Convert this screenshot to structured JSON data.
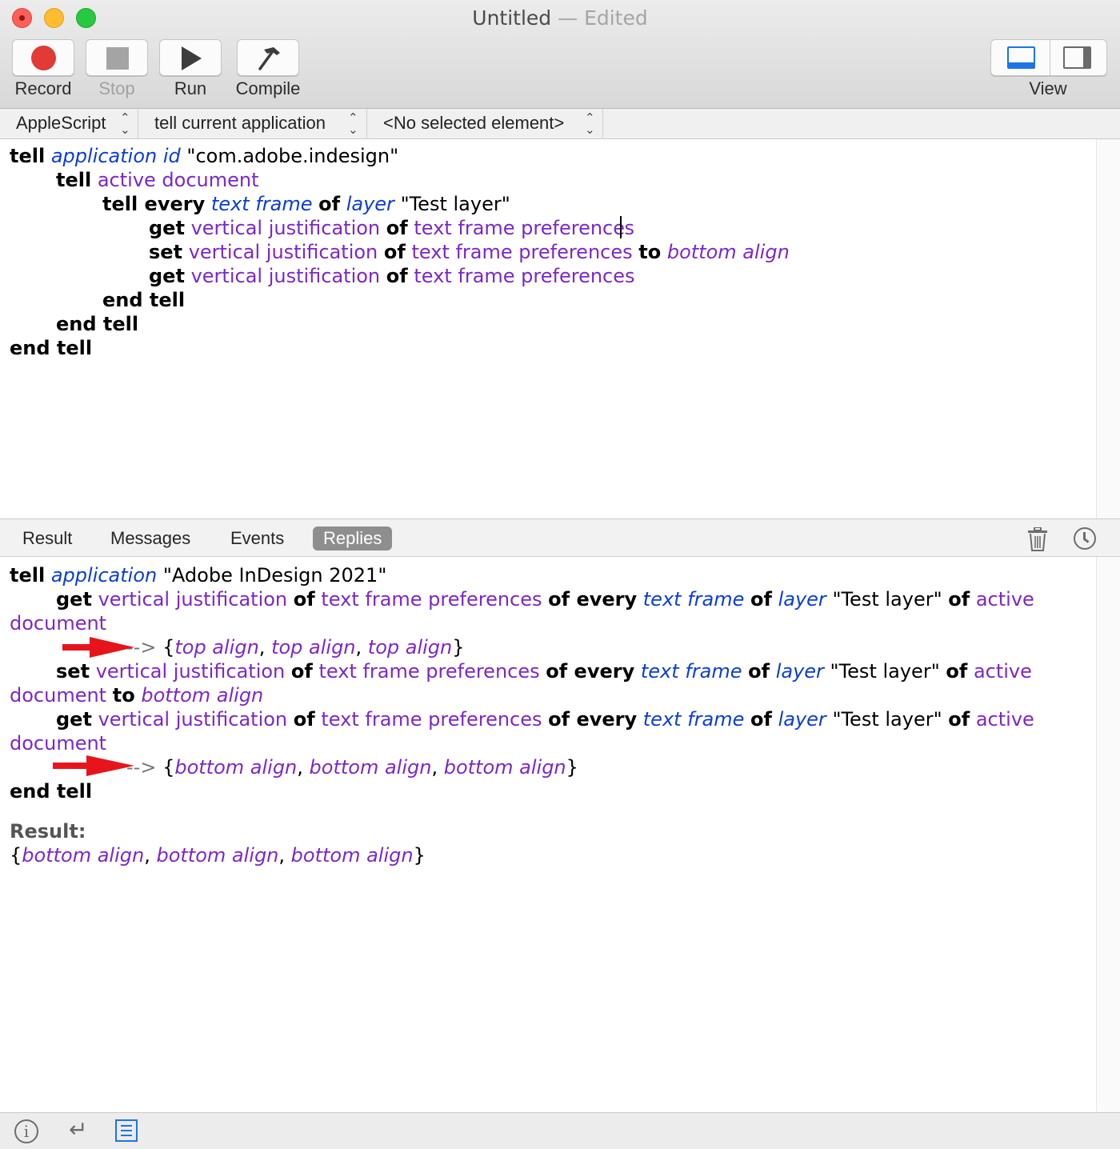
{
  "window": {
    "title": "Untitled",
    "separator": " — ",
    "status": "Edited"
  },
  "toolbar": {
    "record": "Record",
    "stop": "Stop",
    "run": "Run",
    "compile": "Compile",
    "view": "View"
  },
  "navbar": {
    "language": "AppleScript",
    "target": "tell current application",
    "element": "<No selected element>"
  },
  "script": {
    "l1": [
      "tell",
      "application",
      "id",
      "\"com.adobe.indesign\""
    ],
    "l2": [
      "tell",
      "active document"
    ],
    "l3": [
      "tell every",
      "text frame",
      "of",
      "layer",
      "\"Test layer\""
    ],
    "l4": [
      "get",
      "vertical justification",
      "of",
      "text frame preference",
      "s"
    ],
    "l5": [
      "set",
      "vertical justification",
      "of",
      "text frame preferences",
      "to",
      "bottom align"
    ],
    "l6": [
      "get",
      "vertical justification",
      "of",
      "text frame preferences"
    ],
    "l7": "end tell",
    "l8": "end tell",
    "l9": "end tell"
  },
  "log_tabs": [
    "Result",
    "Messages",
    "Events",
    "Replies"
  ],
  "log_active_tab": "Replies",
  "log": {
    "r1": [
      "tell",
      "application",
      "\"Adobe InDesign 2021\""
    ],
    "get_vj": "get",
    "vj": "vertical justification",
    "of": "of",
    "tfp": "text frame preferences",
    "of_every": "of every",
    "tf": "text frame",
    "layer": "layer",
    "test_layer": "\"Test layer\"",
    "active": "active",
    "document": "document",
    "set": "set",
    "to": "to",
    "bottom_align": "bottom align",
    "reply1_gt": "--> ",
    "reply1": [
      "top align",
      "top align",
      "top align"
    ],
    "reply2_gt": "--> ",
    "reply2": [
      "bottom align",
      "bottom align",
      "bottom align"
    ],
    "end_tell": "end tell",
    "result_label": "Result:",
    "result": [
      "bottom align",
      "bottom align",
      "bottom align"
    ]
  },
  "colors": {
    "keyword": "#000000",
    "application_class": "#0a3dd8",
    "property": "#7e26c9",
    "annotation_arrow": "#e8141b",
    "accent": "#1d74e8"
  }
}
